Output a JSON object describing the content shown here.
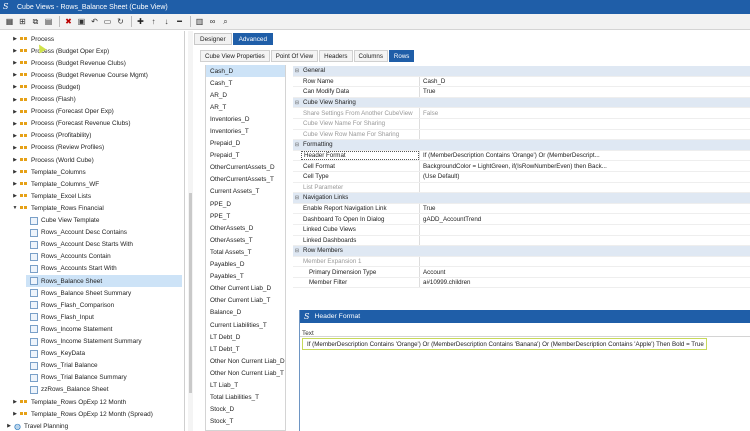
{
  "window": {
    "title": "Cube Views - Rows_Balance Sheet (Cube View)"
  },
  "toolbar": {
    "icons": [
      "grid-icon",
      "tree-icon",
      "copy-icon",
      "doc-icon",
      "delete-icon",
      "calendar-icon",
      "undo-icon",
      "save-icon",
      "refresh-icon",
      "add-icon",
      "move-up-icon",
      "move-down-icon",
      "remove-icon",
      "chart-icon",
      "binoculars-icon",
      "search-icon"
    ]
  },
  "tree": {
    "items": [
      {
        "label": "Process",
        "type": "group",
        "indent": 1
      },
      {
        "label": "Process (Budget Oper Exp)",
        "type": "group",
        "indent": 1
      },
      {
        "label": "Process (Budget Revenue Clubs)",
        "type": "group",
        "indent": 1
      },
      {
        "label": "Process (Budget Revenue Course Mgmt)",
        "type": "group",
        "indent": 1
      },
      {
        "label": "Process (Budget)",
        "type": "group",
        "indent": 1
      },
      {
        "label": "Process (Flash)",
        "type": "group",
        "indent": 1
      },
      {
        "label": "Process (Forecast Oper Exp)",
        "type": "group",
        "indent": 1
      },
      {
        "label": "Process (Forecast Revenue Clubs)",
        "type": "group",
        "indent": 1
      },
      {
        "label": "Process (Profitability)",
        "type": "group",
        "indent": 1
      },
      {
        "label": "Process (Review Profiles)",
        "type": "group",
        "indent": 1
      },
      {
        "label": "Process (World Cube)",
        "type": "group",
        "indent": 1
      },
      {
        "label": "Template_Columns",
        "type": "group",
        "indent": 1
      },
      {
        "label": "Template_Columns_WF",
        "type": "group",
        "indent": 1
      },
      {
        "label": "Template_Excel Lists",
        "type": "group",
        "indent": 1
      },
      {
        "label": "Template_Rows Financial",
        "type": "group-open",
        "indent": 1
      },
      {
        "label": "Cube View Template",
        "type": "doc",
        "indent": 2
      },
      {
        "label": "Rows_Account Desc Contains",
        "type": "doc",
        "indent": 2
      },
      {
        "label": "Rows_Account Desc Starts With",
        "type": "doc",
        "indent": 2
      },
      {
        "label": "Rows_Accounts Contain",
        "type": "doc",
        "indent": 2
      },
      {
        "label": "Rows_Accounts Start With",
        "type": "doc",
        "indent": 2
      },
      {
        "label": "Rows_Balance Sheet",
        "type": "doc",
        "indent": 2,
        "selected": true
      },
      {
        "label": "Rows_Balance Sheet Summary",
        "type": "doc",
        "indent": 2
      },
      {
        "label": "Rows_Flash_Comparison",
        "type": "doc",
        "indent": 2
      },
      {
        "label": "Rows_Flash_Input",
        "type": "doc",
        "indent": 2
      },
      {
        "label": "Rows_Income Statement",
        "type": "doc",
        "indent": 2
      },
      {
        "label": "Rows_Income Statement Summary",
        "type": "doc",
        "indent": 2
      },
      {
        "label": "Rows_KeyData",
        "type": "doc",
        "indent": 2
      },
      {
        "label": "Rows_Trial Balance",
        "type": "doc",
        "indent": 2
      },
      {
        "label": "Rows_Trial Balance Summary",
        "type": "doc",
        "indent": 2
      },
      {
        "label": "zzRows_Balance Sheet",
        "type": "doc",
        "indent": 2
      },
      {
        "label": "Template_Rows OpExp 12 Month",
        "type": "group",
        "indent": 1
      },
      {
        "label": "Template_Rows OpExp 12 Month (Spread)",
        "type": "group",
        "indent": 1
      },
      {
        "label": "Travel Planning",
        "type": "globe",
        "indent": 0
      }
    ]
  },
  "tabs_main": [
    {
      "label": "Designer",
      "active": false
    },
    {
      "label": "Advanced",
      "active": true
    }
  ],
  "tabs_sub": [
    {
      "label": "Cube View Properties",
      "active": false
    },
    {
      "label": "Point Of View",
      "active": false
    },
    {
      "label": "Headers",
      "active": false
    },
    {
      "label": "Columns",
      "active": false
    },
    {
      "label": "Rows",
      "active": true
    }
  ],
  "rows_list": [
    "Cash_D",
    "Cash_T",
    "AR_D",
    "AR_T",
    "Inventories_D",
    "Inventories_T",
    "Prepaid_D",
    "Prepaid_T",
    "OtherCurrentAssets_D",
    "OtherCurrentAssets_T",
    "Current Assets_T",
    "PPE_D",
    "PPE_T",
    "OtherAssets_D",
    "OtherAssets_T",
    "Total Assets_T",
    "Payables_D",
    "Payables_T",
    "Other Current Liab_D",
    "Other Current Liab_T",
    "Balance_D",
    "Current Liabilities_T",
    "LT Debt_D",
    "LT Debt_T",
    "Other Non Current Liab_D",
    "Other Non Current Liab_T",
    "LT Liab_T",
    "Total Liabilities_T",
    "Stock_D",
    "Stock_T"
  ],
  "properties": [
    {
      "key": "General",
      "value": "",
      "kind": "cat"
    },
    {
      "key": "Row Name",
      "value": "Cash_D",
      "kind": "row"
    },
    {
      "key": "Can Modify Data",
      "value": "True",
      "kind": "row"
    },
    {
      "key": "Cube View Sharing",
      "value": "",
      "kind": "cat"
    },
    {
      "key": "Share Settings From Another CubeView",
      "value": "False",
      "kind": "dis"
    },
    {
      "key": "Cube View Name For Sharing",
      "value": "",
      "kind": "dis"
    },
    {
      "key": "Cube View Row Name For Sharing",
      "value": "",
      "kind": "dis"
    },
    {
      "key": "Formatting",
      "value": "",
      "kind": "cat"
    },
    {
      "key": "Header Format",
      "value": "If  (MemberDescription Contains 'Orange') Or (MemberDescript...",
      "kind": "hl"
    },
    {
      "key": "Cell Format",
      "value": "BackgroundColor = LightGreen,  if(IsRowNumberEven) then Back...",
      "kind": "row"
    },
    {
      "key": "Cell Type",
      "value": "(Use Default)",
      "kind": "row"
    },
    {
      "key": "List Parameter",
      "value": "",
      "kind": "dis"
    },
    {
      "key": "Navigation Links",
      "value": "",
      "kind": "cat"
    },
    {
      "key": "Enable Report Navigation Link",
      "value": "True",
      "kind": "row"
    },
    {
      "key": "Dashboard To Open In Dialog",
      "value": "gADD_AccountTrend",
      "kind": "row"
    },
    {
      "key": "Linked Cube Views",
      "value": "",
      "kind": "row"
    },
    {
      "key": "Linked Dashboards",
      "value": "",
      "kind": "row"
    },
    {
      "key": "Row Members",
      "value": "",
      "kind": "cat"
    },
    {
      "key": "Member Expansion 1",
      "value": "",
      "kind": "dis"
    },
    {
      "key": "Primary Dimension Type",
      "value": "Account",
      "kind": "sub"
    },
    {
      "key": "Member Filter",
      "value": "a#10999.children",
      "kind": "sub"
    }
  ],
  "dialog": {
    "title": "Header Format",
    "text_label": "Text",
    "formula": "If  (MemberDescription Contains 'Orange') Or (MemberDescription Contains 'Banana') Or (MemberDescription Contains 'Apple') Then Bold = True"
  }
}
